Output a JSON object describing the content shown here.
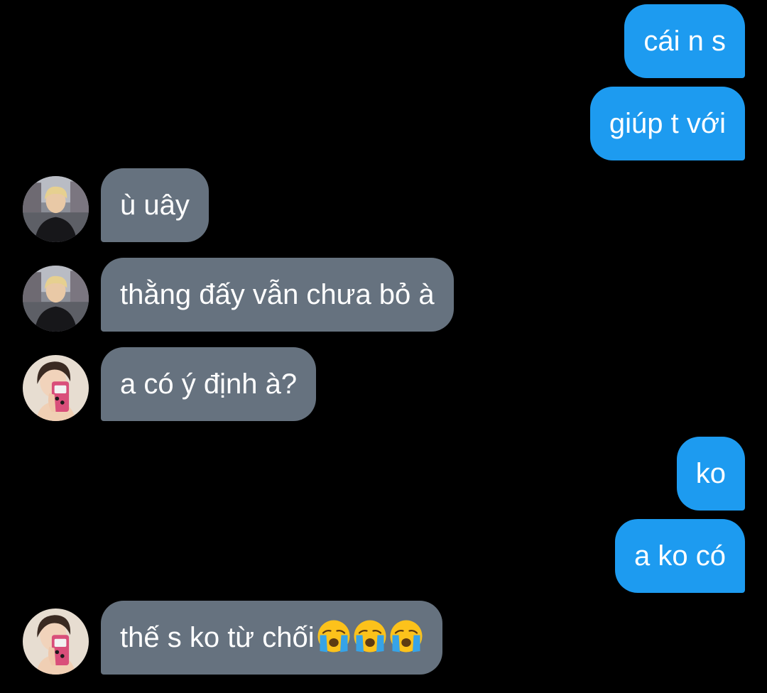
{
  "colors": {
    "background": "#000000",
    "sent_bubble": "#1d9bf0",
    "received_bubble": "#66727f",
    "text": "#ffffff"
  },
  "messages": [
    {
      "direction": "sent",
      "text": "cái n s"
    },
    {
      "direction": "sent",
      "text": "giúp t với"
    },
    {
      "direction": "received",
      "avatar": "avatar-blond-hoodie",
      "text": "ù uây"
    },
    {
      "direction": "received",
      "avatar": "avatar-blond-hoodie",
      "text": "thằng đấy vẫn chưa bỏ à"
    },
    {
      "direction": "received",
      "avatar": "avatar-mirror-selfie",
      "text": "a có ý định à?"
    },
    {
      "direction": "sent",
      "text": "ko"
    },
    {
      "direction": "sent",
      "text": "a ko có"
    },
    {
      "direction": "received",
      "avatar": "avatar-mirror-selfie",
      "text": "thế s ko từ chối",
      "emojis": [
        "loudly-crying-face",
        "loudly-crying-face",
        "loudly-crying-face"
      ]
    }
  ]
}
